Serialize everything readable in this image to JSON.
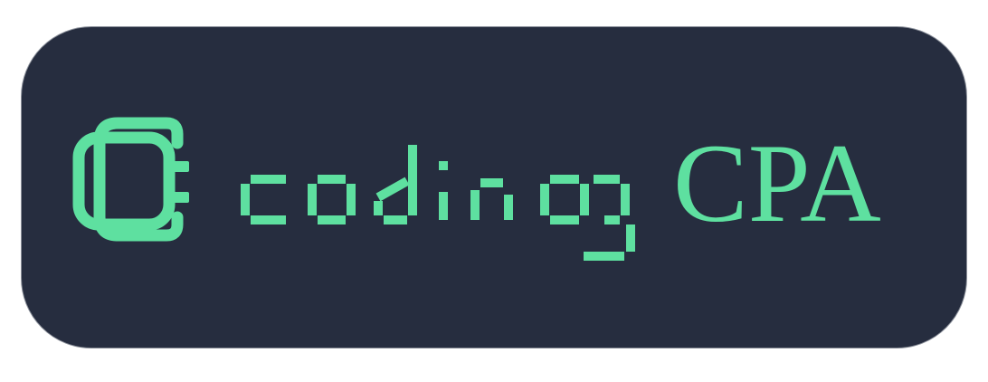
{
  "logo": {
    "wordmark_segment": "coding",
    "wordmark_serif": "CPA",
    "icon": "interlocked-c-icon",
    "colors": {
      "background": "#262d3f",
      "border": "#8a8f99",
      "accent": "#5ee0a0",
      "page": "#ffffff"
    }
  }
}
